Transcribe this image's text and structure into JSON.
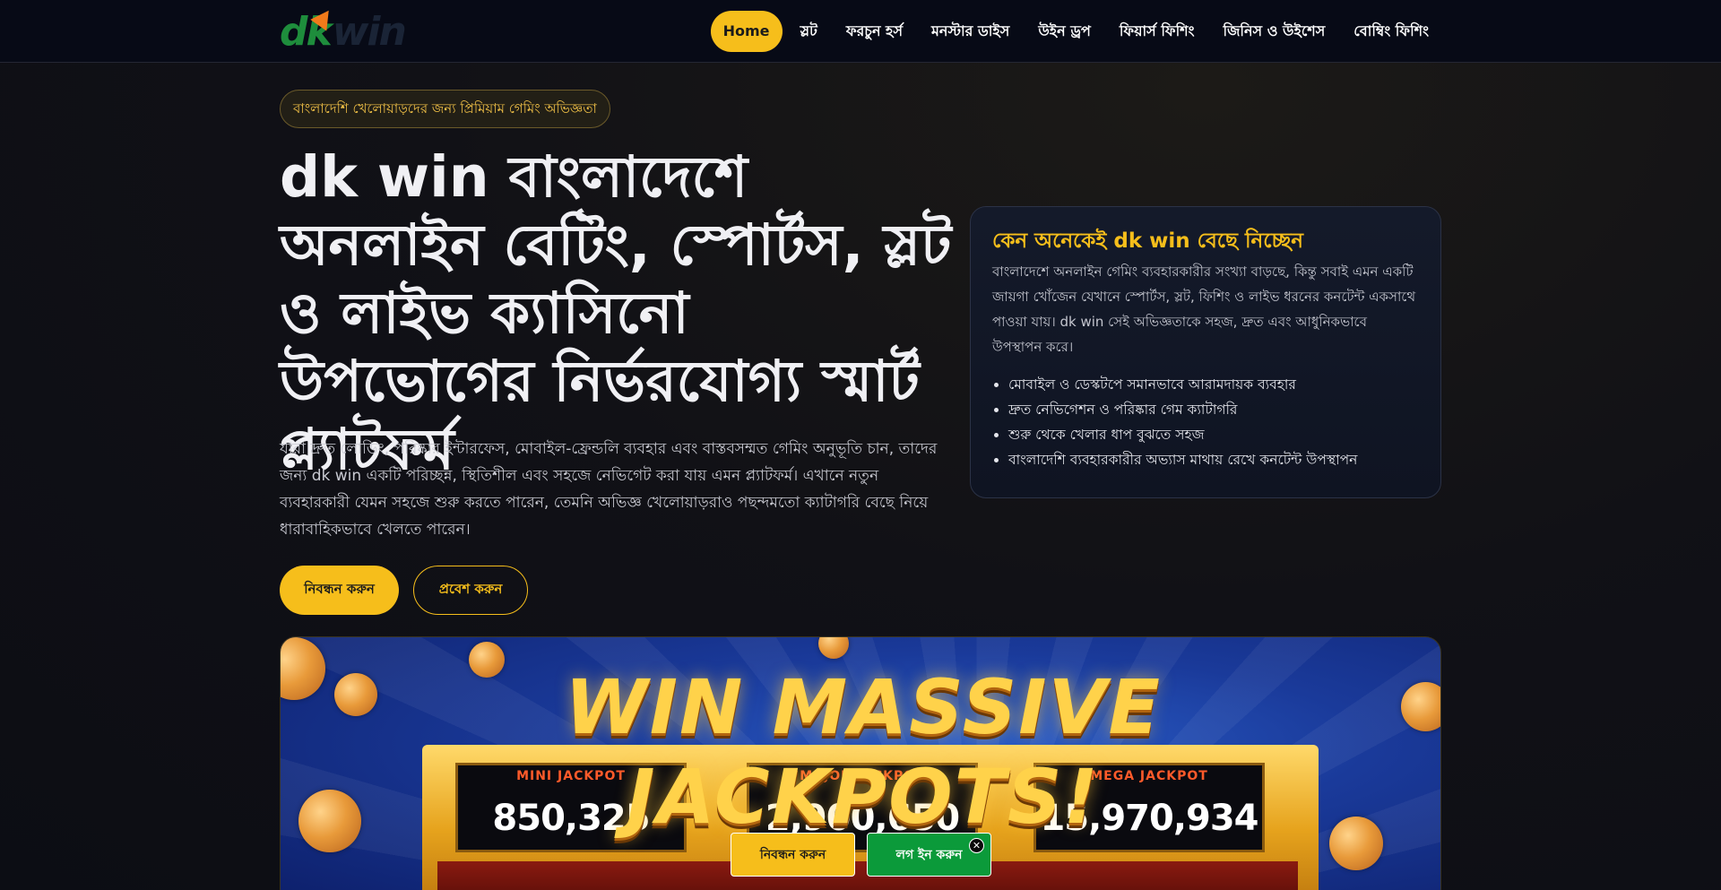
{
  "brand": {
    "logo_text_1": "dk",
    "logo_text_2": "win"
  },
  "nav": {
    "items": [
      {
        "label": "Home"
      },
      {
        "label": "স্লট"
      },
      {
        "label": "ফরচুন হর্স"
      },
      {
        "label": "মনস্টার ডাইস"
      },
      {
        "label": "উইন ড্রপ"
      },
      {
        "label": "ফিয়ার্স ফিশিং"
      },
      {
        "label": "জিনিস ও উইশেস"
      },
      {
        "label": "বোম্বিং ফিশিং"
      }
    ]
  },
  "hero": {
    "pill": "বাংলাদেশি খেলোয়াড়দের জন্য প্রিমিয়াম গেমিং অভিজ্ঞতা",
    "title": "dk win বাংলাদেশে অনলাইন বেটিং, স্পোর্টস, স্লট ও লাইভ ক্যাসিনো উপভোগের নির্ভরযোগ্য স্মার্ট প্ল্যাটফর্ম",
    "description": "যারা দ্রুত লোডিং, পরিষ্কার ইন্টারফেস, মোবাইল-ফ্রেন্ডলি ব্যবহার এবং বাস্তবসম্মত গেমিং অনুভূতি চান, তাদের জন্য dk win একটি পরিচ্ছন্ন, স্থিতিশীল এবং সহজে নেভিগেট করা যায় এমন প্ল্যাটফর্ম। এখানে নতুন ব্যবহারকারী যেমন সহজে শুরু করতে পারেন, তেমনি অভিজ্ঞ খেলোয়াড়রাও পছন্দমতো ক্যাটাগরি বেছে নিয়ে ধারাবাহিকভাবে খেলতে পারেন।",
    "register_label": "নিবন্ধন করুন",
    "login_label": "প্রবেশ করুন"
  },
  "card": {
    "title": "কেন অনেকেই dk win বেছে নিচ্ছেন",
    "text": "বাংলাদেশে অনলাইন গেমিং ব্যবহারকারীর সংখ্যা বাড়ছে, কিন্তু সবাই এমন একটি জায়গা খোঁজেন যেখানে স্পোর্টস, স্লট, ফিশিং ও লাইভ ধরনের কনটেন্ট একসাথে পাওয়া যায়। dk win সেই অভিজ্ঞতাকে সহজ, দ্রুত এবং আধুনিকভাবে উপস্থাপন করে।",
    "points": [
      "মোবাইল ও ডেস্কটপে সমানভাবে আরামদায়ক ব্যবহার",
      "দ্রুত নেভিগেশন ও পরিষ্কার গেম ক্যাটাগরি",
      "শুরু থেকে খেলার ধাপ বুঝতে সহজ",
      "বাংলাদেশি ব্যবহারকারীর অভ্যাস মাথায় রেখে কনটেন্ট উপস্থাপন"
    ]
  },
  "banner": {
    "headline": "WIN MASSIVE JACKPOTS!",
    "jackpots": [
      {
        "label": "MINI JACKPOT",
        "value": "850,325"
      },
      {
        "label": "MAJOR JACKPOT",
        "value": "2,900,650"
      },
      {
        "label": "MEGA JACKPOT",
        "value": "15,970,934"
      }
    ]
  },
  "floating": {
    "register_label": "নিবন্ধন করুন",
    "login_label": "লগ ইন করুন",
    "close_glyph": "✕"
  },
  "colors": {
    "accent": "#f6be1b",
    "login_green": "#0b9a3a",
    "background": "#111116"
  }
}
